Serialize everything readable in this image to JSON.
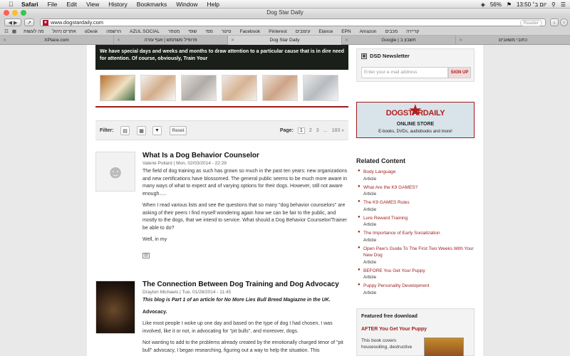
{
  "menubar": {
    "items": [
      "Safari",
      "File",
      "Edit",
      "View",
      "History",
      "Bookmarks",
      "Window",
      "Help"
    ],
    "battery": "56%",
    "clock": "יום ב׳ 13:50"
  },
  "window": {
    "title": "Dog Star Daily"
  },
  "address": {
    "url": "www.dogstardaily.com",
    "reader": "Reader"
  },
  "bookmarks": [
    "קריירה",
    "מכבים",
    "Amazon",
    "EPN",
    "Elance",
    "עיצובים",
    "Pinterest",
    "Facebook",
    "טיטר",
    "ממי",
    "שופי",
    "מטפר",
    "AZUL SOCIAL",
    "הרשמה",
    "oDesk",
    "אתרים ניהול",
    "מה לעשות"
  ],
  "tabs": [
    "XPlace.com",
    "פרופיל משתמש | אגף עזרה",
    "Dog Star Daily",
    "Google | חשבון ב",
    "כתובי משאבים"
  ],
  "hero": {
    "text": "We have special days and weeks and months to draw attention to a particular cause that is in dire need for attention. Of course, obviously, Train Your"
  },
  "filter": {
    "label": "Filter:",
    "reset": "Reset",
    "page_label": "Page:",
    "pages": [
      "1",
      "2",
      "3",
      "...",
      "183 »"
    ]
  },
  "articles": [
    {
      "title": "What Is a Dog Behavior Counselor",
      "meta": "Valerie Pollard  |  Mon, 02/03/2014 - 22:29",
      "paragraphs": [
        "The field of dog training as such has grown so much in the past ten years:  new organizations and new certifications have blossomed.  The general public seems to be much more aware in many ways of what to expect and of varying options for their dogs. However, still not aware enough.....",
        "When I read various lists and see the questions that so many \"dog behavior counselors\" are asking of their peers I find myself wondering again how we can be fair to the public, and mostly to the dogs, that we intend to service.    What should a Dog Behavior Counselor/Trainer be able to do?",
        "Well, in my"
      ]
    },
    {
      "title": "The Connection Between Dog Training and Dog Advocacy",
      "meta": "Drayton Michaels  |  Tue, 01/28/2014 - 11:45",
      "intro": "This blog is Part 1 of an article for No More Lies Bull Breed Magiazne in the UK.",
      "subhead": "Advocacy.",
      "paragraphs": [
        "Like most people I woke up one day and based on the type of dog I had chosen, I was involved, like it or not, in advocating for \"pit bulls\", and moreover, dogs.",
        "Not wanting to add to the problems already created by the emotionally charged tenor of \"pit bull\" advocacy, I began researching, figuring out a way to help the situation. This"
      ]
    }
  ],
  "newsletter": {
    "title": "DSD Newsletter",
    "placeholder": "Enter your e-mail address",
    "button": "SIGN UP"
  },
  "banner": {
    "title": "DOGSTARDAILY",
    "subtitle": "ONLINE STORE",
    "tagline": "E-books, DVDs, audiobooks and more!"
  },
  "related": {
    "title": "Related Content",
    "items": [
      {
        "title": "Body Language",
        "kind": "Article"
      },
      {
        "title": "What Are the K9 GAMES?",
        "kind": "Article"
      },
      {
        "title": "The K9 GAMES Rules",
        "kind": "Article"
      },
      {
        "title": "Lure Reward Training",
        "kind": "Article"
      },
      {
        "title": "The Importance of Early Socialization",
        "kind": "Article"
      },
      {
        "title": "Open Paw's Guide To The First Two Weeks With Your New Dog",
        "kind": "Article"
      },
      {
        "title": "BEFORE You Get Your Puppy",
        "kind": "Article"
      },
      {
        "title": "Puppy Personality Development",
        "kind": "Article"
      }
    ]
  },
  "featured": {
    "heading": "Featured free download",
    "title": "AFTER You Get Your Puppy",
    "desc": "This book covers housesoiling, destructive"
  },
  "colors": {
    "accent": "#9c1c1c",
    "hero_bg": "#1a1f1a",
    "page_bg": "#e9e9e9"
  }
}
